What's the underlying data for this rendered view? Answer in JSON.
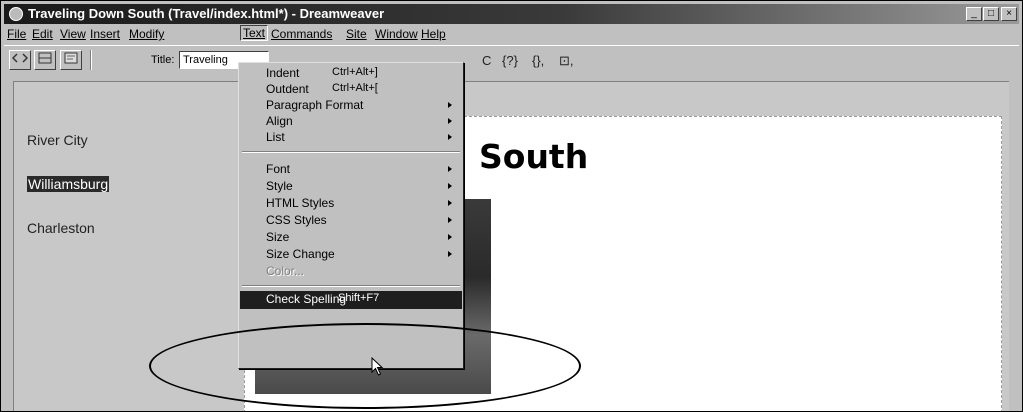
{
  "window": {
    "title": "Traveling Down South (Travel/index.html*) - Dreamweaver",
    "controls": {
      "minimize": "_",
      "maximize": "□",
      "close": "×"
    }
  },
  "menubar": {
    "items": [
      {
        "label": "File"
      },
      {
        "label": "Edit"
      },
      {
        "label": "View"
      },
      {
        "label": "Insert"
      },
      {
        "label": "Modify"
      },
      {
        "label": "Text"
      },
      {
        "label": "Commands"
      },
      {
        "label": "Site"
      },
      {
        "label": "Window"
      },
      {
        "label": "Help"
      }
    ]
  },
  "toolbar": {
    "title_label": "Title:",
    "title_value": "Traveling",
    "glyphs": [
      "C",
      "{?}",
      "{},",
      "⊡,"
    ]
  },
  "sidebar": {
    "links": [
      "River City",
      "Williamsburg",
      "Charleston"
    ]
  },
  "content": {
    "heading": "South"
  },
  "text_menu": {
    "items": [
      {
        "label": "Indent",
        "shortcut": "Ctrl+Alt+]"
      },
      {
        "label": "Outdent",
        "shortcut": "Ctrl+Alt+["
      },
      {
        "label": "Paragraph Format",
        "submenu": true
      },
      {
        "label": "Align",
        "submenu": true
      },
      {
        "label": "List",
        "submenu": true
      },
      {
        "label": "Font",
        "submenu": true
      },
      {
        "label": "Style",
        "submenu": true
      },
      {
        "label": "HTML Styles",
        "submenu": true
      },
      {
        "label": "CSS Styles",
        "submenu": true
      },
      {
        "label": "Size",
        "submenu": true
      },
      {
        "label": "Size Change",
        "submenu": true
      },
      {
        "label": "Color...",
        "disabled": true
      },
      {
        "label": "Check Spelling",
        "shortcut": "Shift+F7",
        "highlighted": true
      }
    ]
  },
  "colors": {
    "chrome": "#c0c0c0",
    "highlight": "#1e1e1e",
    "titlebar": "#1a1a1a"
  }
}
